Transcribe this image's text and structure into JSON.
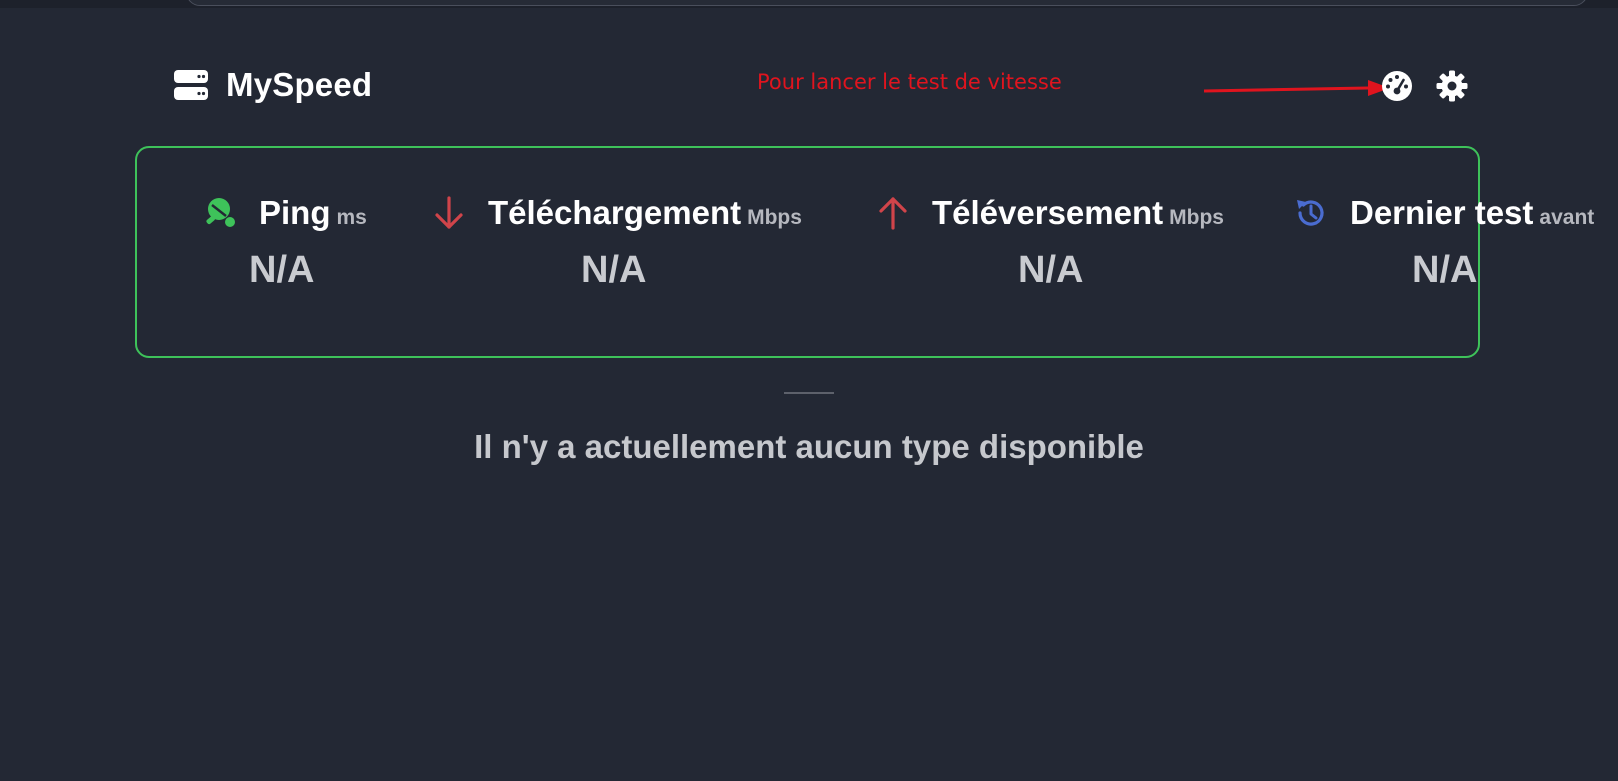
{
  "app": {
    "title": "MySpeed"
  },
  "annotation": {
    "text": "Pour lancer le test de vitesse",
    "color": "#e0141e"
  },
  "toolbar": {
    "speedtest_icon": "speedometer-icon",
    "settings_icon": "gear-icon"
  },
  "stats": [
    {
      "label": "Ping",
      "unit": "ms",
      "value": "N/A",
      "icon": "ping-pong-icon",
      "color": "#3ec25a"
    },
    {
      "label": "Téléchargement",
      "unit": "Mbps",
      "value": "N/A",
      "icon": "arrow-down-icon",
      "color": "#d0444a"
    },
    {
      "label": "Téléversement",
      "unit": "Mbps",
      "value": "N/A",
      "icon": "arrow-up-icon",
      "color": "#d0444a"
    },
    {
      "label": "Dernier test",
      "unit": "avant",
      "value": "N/A",
      "icon": "history-icon",
      "color": "#4a6cd0"
    }
  ],
  "colors": {
    "background": "#232834",
    "box_border": "#3ec25a"
  },
  "empty_state": {
    "message": "Il n'y a actuellement aucun type disponible"
  }
}
